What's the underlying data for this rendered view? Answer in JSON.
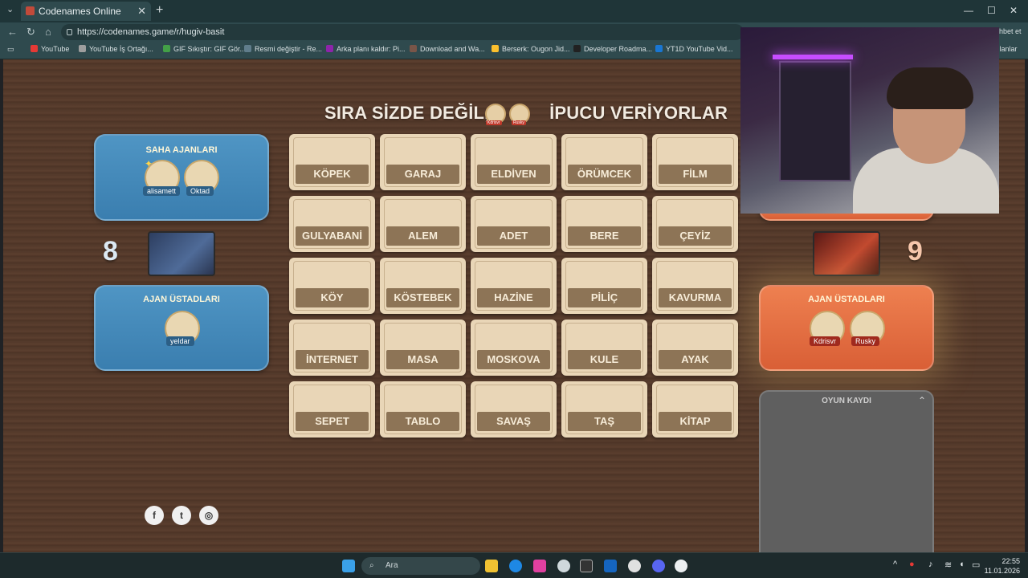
{
  "browser": {
    "tab_title": "Codenames Online",
    "url": "https://codenames.game/r/hugiv-basit",
    "bookmarks": [
      {
        "label": "YouTube",
        "color": "#e53935"
      },
      {
        "label": "YouTube İş Ortağı...",
        "color": "#9e9e9e"
      },
      {
        "label": "GIF Sıkıştır: GIF Gör...",
        "color": "#43a047"
      },
      {
        "label": "Resmi değiştir - Re...",
        "color": "#607d8b"
      },
      {
        "label": "Arka planı kaldır: Pi...",
        "color": "#8e24aa"
      },
      {
        "label": "Download and Wa...",
        "color": "#795548"
      },
      {
        "label": "Berserk: Ougon Jid...",
        "color": "#fbc02d"
      },
      {
        "label": "Developer Roadma...",
        "color": "#212121"
      },
      {
        "label": "YT1D YouTube Vid...",
        "color": "#1976d2"
      }
    ],
    "bookmarks_more": "ılanlar",
    "edge_text": "hbet et"
  },
  "game": {
    "headline_left": "SIRA SİZDE DEĞİL,",
    "headline_right": "İPUCU VERİYORLAR",
    "headline_avatars": [
      "Kdrisvr",
      "Rusky"
    ],
    "blue": {
      "score": "8",
      "field_title": "SAHA AJANLARI",
      "field_players": [
        "alisamett",
        "Oktad"
      ],
      "master_title": "AJAN ÜSTADLARI",
      "master_players": [
        "yeldar"
      ]
    },
    "red": {
      "score": "9",
      "master_title": "AJAN ÜSTADLARI",
      "master_players": [
        "Kdrisvr",
        "Rusky"
      ]
    },
    "cards": [
      "KÖPEK",
      "GARAJ",
      "ELDİVEN",
      "ÖRÜMCEK",
      "FİLM",
      "GULYABANİ",
      "ALEM",
      "ADET",
      "BERE",
      "ÇEYİZ",
      "KÖY",
      "KÖSTEBEK",
      "HAZİNE",
      "PİLİÇ",
      "KAVURMA",
      "İNTERNET",
      "MASA",
      "MOSKOVA",
      "KULE",
      "AYAK",
      "SEPET",
      "TABLO",
      "SAVAŞ",
      "TAŞ",
      "KİTAP"
    ],
    "log_title": "OYUN KAYDI",
    "social": [
      "facebook-icon",
      "twitter-icon",
      "instagram-icon"
    ]
  },
  "taskbar": {
    "search_placeholder": "Ara",
    "time": "22:55",
    "date": "11.01.2026"
  }
}
